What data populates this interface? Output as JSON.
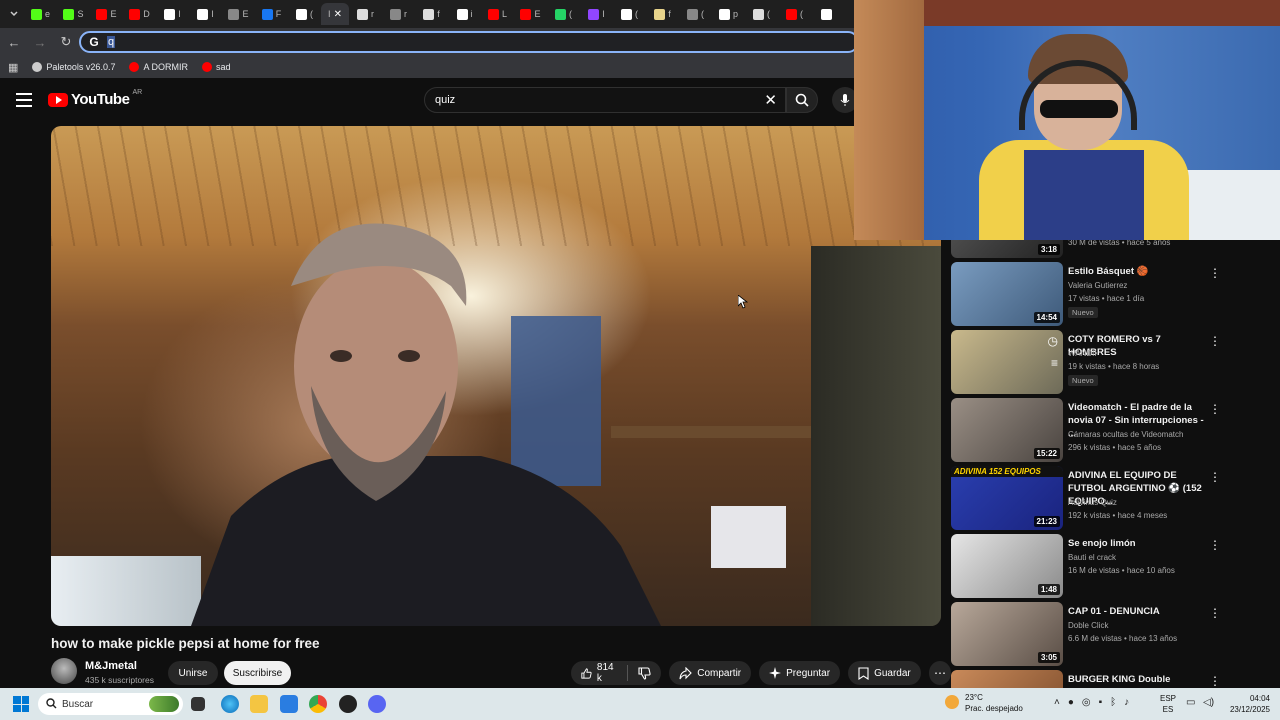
{
  "browser": {
    "tabs": [
      {
        "icon": "kick-icon",
        "color": "#53fc18",
        "label": "e"
      },
      {
        "icon": "kick-icon",
        "color": "#53fc18",
        "label": "S"
      },
      {
        "icon": "youtube-icon",
        "color": "#ff0000",
        "label": "E"
      },
      {
        "icon": "youtube-icon",
        "color": "#ff0000",
        "label": "D"
      },
      {
        "icon": "x-icon",
        "color": "#ffffff",
        "label": "I"
      },
      {
        "icon": "x-icon",
        "color": "#ffffff",
        "label": "I"
      },
      {
        "icon": "globe-icon",
        "color": "#888888",
        "label": "E"
      },
      {
        "icon": "facebook-icon",
        "color": "#1877f2",
        "label": "F"
      },
      {
        "icon": "tiktok-icon",
        "color": "#ffffff",
        "label": "("
      },
      {
        "icon": "chrome-icon",
        "color": "#dddddd",
        "label": "r"
      },
      {
        "icon": "globe-icon",
        "color": "#888888",
        "label": "r"
      },
      {
        "icon": "instagram-icon",
        "color": "#dddddd",
        "label": "f"
      },
      {
        "icon": "x-icon",
        "color": "#ffffff",
        "label": "i"
      },
      {
        "icon": "youtube-icon",
        "color": "#ff0000",
        "label": "L"
      },
      {
        "icon": "youtube-icon",
        "color": "#ff0000",
        "label": "E"
      },
      {
        "icon": "whatsapp-icon",
        "color": "#25d366",
        "label": "("
      },
      {
        "icon": "twitch-icon",
        "color": "#9146ff",
        "label": "I"
      },
      {
        "icon": "tiktok-icon",
        "color": "#ffffff",
        "label": "("
      },
      {
        "icon": "globe-icon",
        "color": "#e8d48b",
        "label": "f"
      },
      {
        "icon": "globe-icon",
        "color": "#888888",
        "label": "("
      },
      {
        "icon": "tiktok-icon",
        "color": "#ffffff",
        "label": "p"
      },
      {
        "icon": "chrome-icon",
        "color": "#dddddd",
        "label": "("
      },
      {
        "icon": "youtube-icon",
        "color": "#ff0000",
        "label": "("
      },
      {
        "icon": "tiktok-icon",
        "color": "#ffffff",
        "label": ""
      }
    ],
    "active_tab_label": "I",
    "address_value": "q",
    "bookmarks": [
      {
        "label": "Paletools v26.0.7",
        "color": "#cccccc"
      },
      {
        "label": "A DORMIR",
        "color": "#ff0000"
      },
      {
        "label": "sad",
        "color": "#ff0000"
      }
    ]
  },
  "youtube": {
    "logo_text": "YouTube",
    "country_code": "AR",
    "search_value": "quiz"
  },
  "video": {
    "title": "how to make pickle pepsi at home for free",
    "channel": "M&Jmetal",
    "subscribers": "435 k suscriptores",
    "join_label": "Unirse",
    "subscribe_label": "Suscribirse",
    "likes": "814 k",
    "share_label": "Compartir",
    "ask_label": "Preguntar",
    "save_label": "Guardar"
  },
  "recommendations": {
    "partial_top": {
      "meta": "30 M de vistas • hace 5 años",
      "duration": "3:18"
    },
    "items": [
      {
        "title": "Estilo Básquet 🏀",
        "channel": "Valeria Gutierrez",
        "meta": "17 vistas • hace 1 día",
        "badge": "Nuevo",
        "duration": "14:54",
        "thumb": [
          "#7a9cc0",
          "#3e5a7a"
        ]
      },
      {
        "title": "COTY ROMERO vs 7 HOMBRES",
        "channel": "WANDII",
        "meta": "19 k vistas • hace 8 horas",
        "badge": "Nuevo",
        "duration": "",
        "thumb": [
          "#c9b98c",
          "#6d6a58"
        ]
      },
      {
        "title": "Videomatch - El padre de la novia 07 - Sin interrupciones - ...",
        "channel": "Cámaras ocultas de Videomatch",
        "meta": "296 k vistas • hace 5 años",
        "badge": "",
        "duration": "15:22",
        "thumb": [
          "#9a8f85",
          "#4a4440"
        ]
      },
      {
        "title": "ADIVINA EL EQUIPO DE FUTBOL ARGENTINO ⚽ (152 EQUIPO...",
        "channel": "Adivinus Quiz",
        "meta": "192 k vistas • hace 4 meses",
        "badge": "",
        "duration": "21:23",
        "thumb": [
          "#2a3fb0",
          "#1a237e"
        ]
      },
      {
        "title": "Se enojo limón",
        "channel": "Bauti el crack",
        "meta": "16 M de vistas • hace 10 años",
        "badge": "",
        "duration": "1:48",
        "thumb": [
          "#e6e6e6",
          "#8a8a8a"
        ]
      },
      {
        "title": "CAP 01 - DENUNCIA",
        "channel": "Doble Click",
        "meta": "6.6 M de vistas • hace 13 años",
        "badge": "",
        "duration": "3:05",
        "thumb": [
          "#b8a89a",
          "#5a4e46"
        ]
      },
      {
        "title": "BURGER KING Double whopper",
        "channel": "",
        "meta": "",
        "badge": "",
        "duration": "",
        "thumb": [
          "#c98a5a",
          "#7a4a2a"
        ]
      }
    ],
    "thumb_banner_text": "ADIVINA 152 EQUIPOS"
  },
  "taskbar": {
    "search_placeholder": "Buscar",
    "temperature": "23°C",
    "weather": "Prac. despejado",
    "lang_top": "ESP",
    "lang_bottom": "ES",
    "time": "04:04",
    "date": "23/12/2025"
  }
}
